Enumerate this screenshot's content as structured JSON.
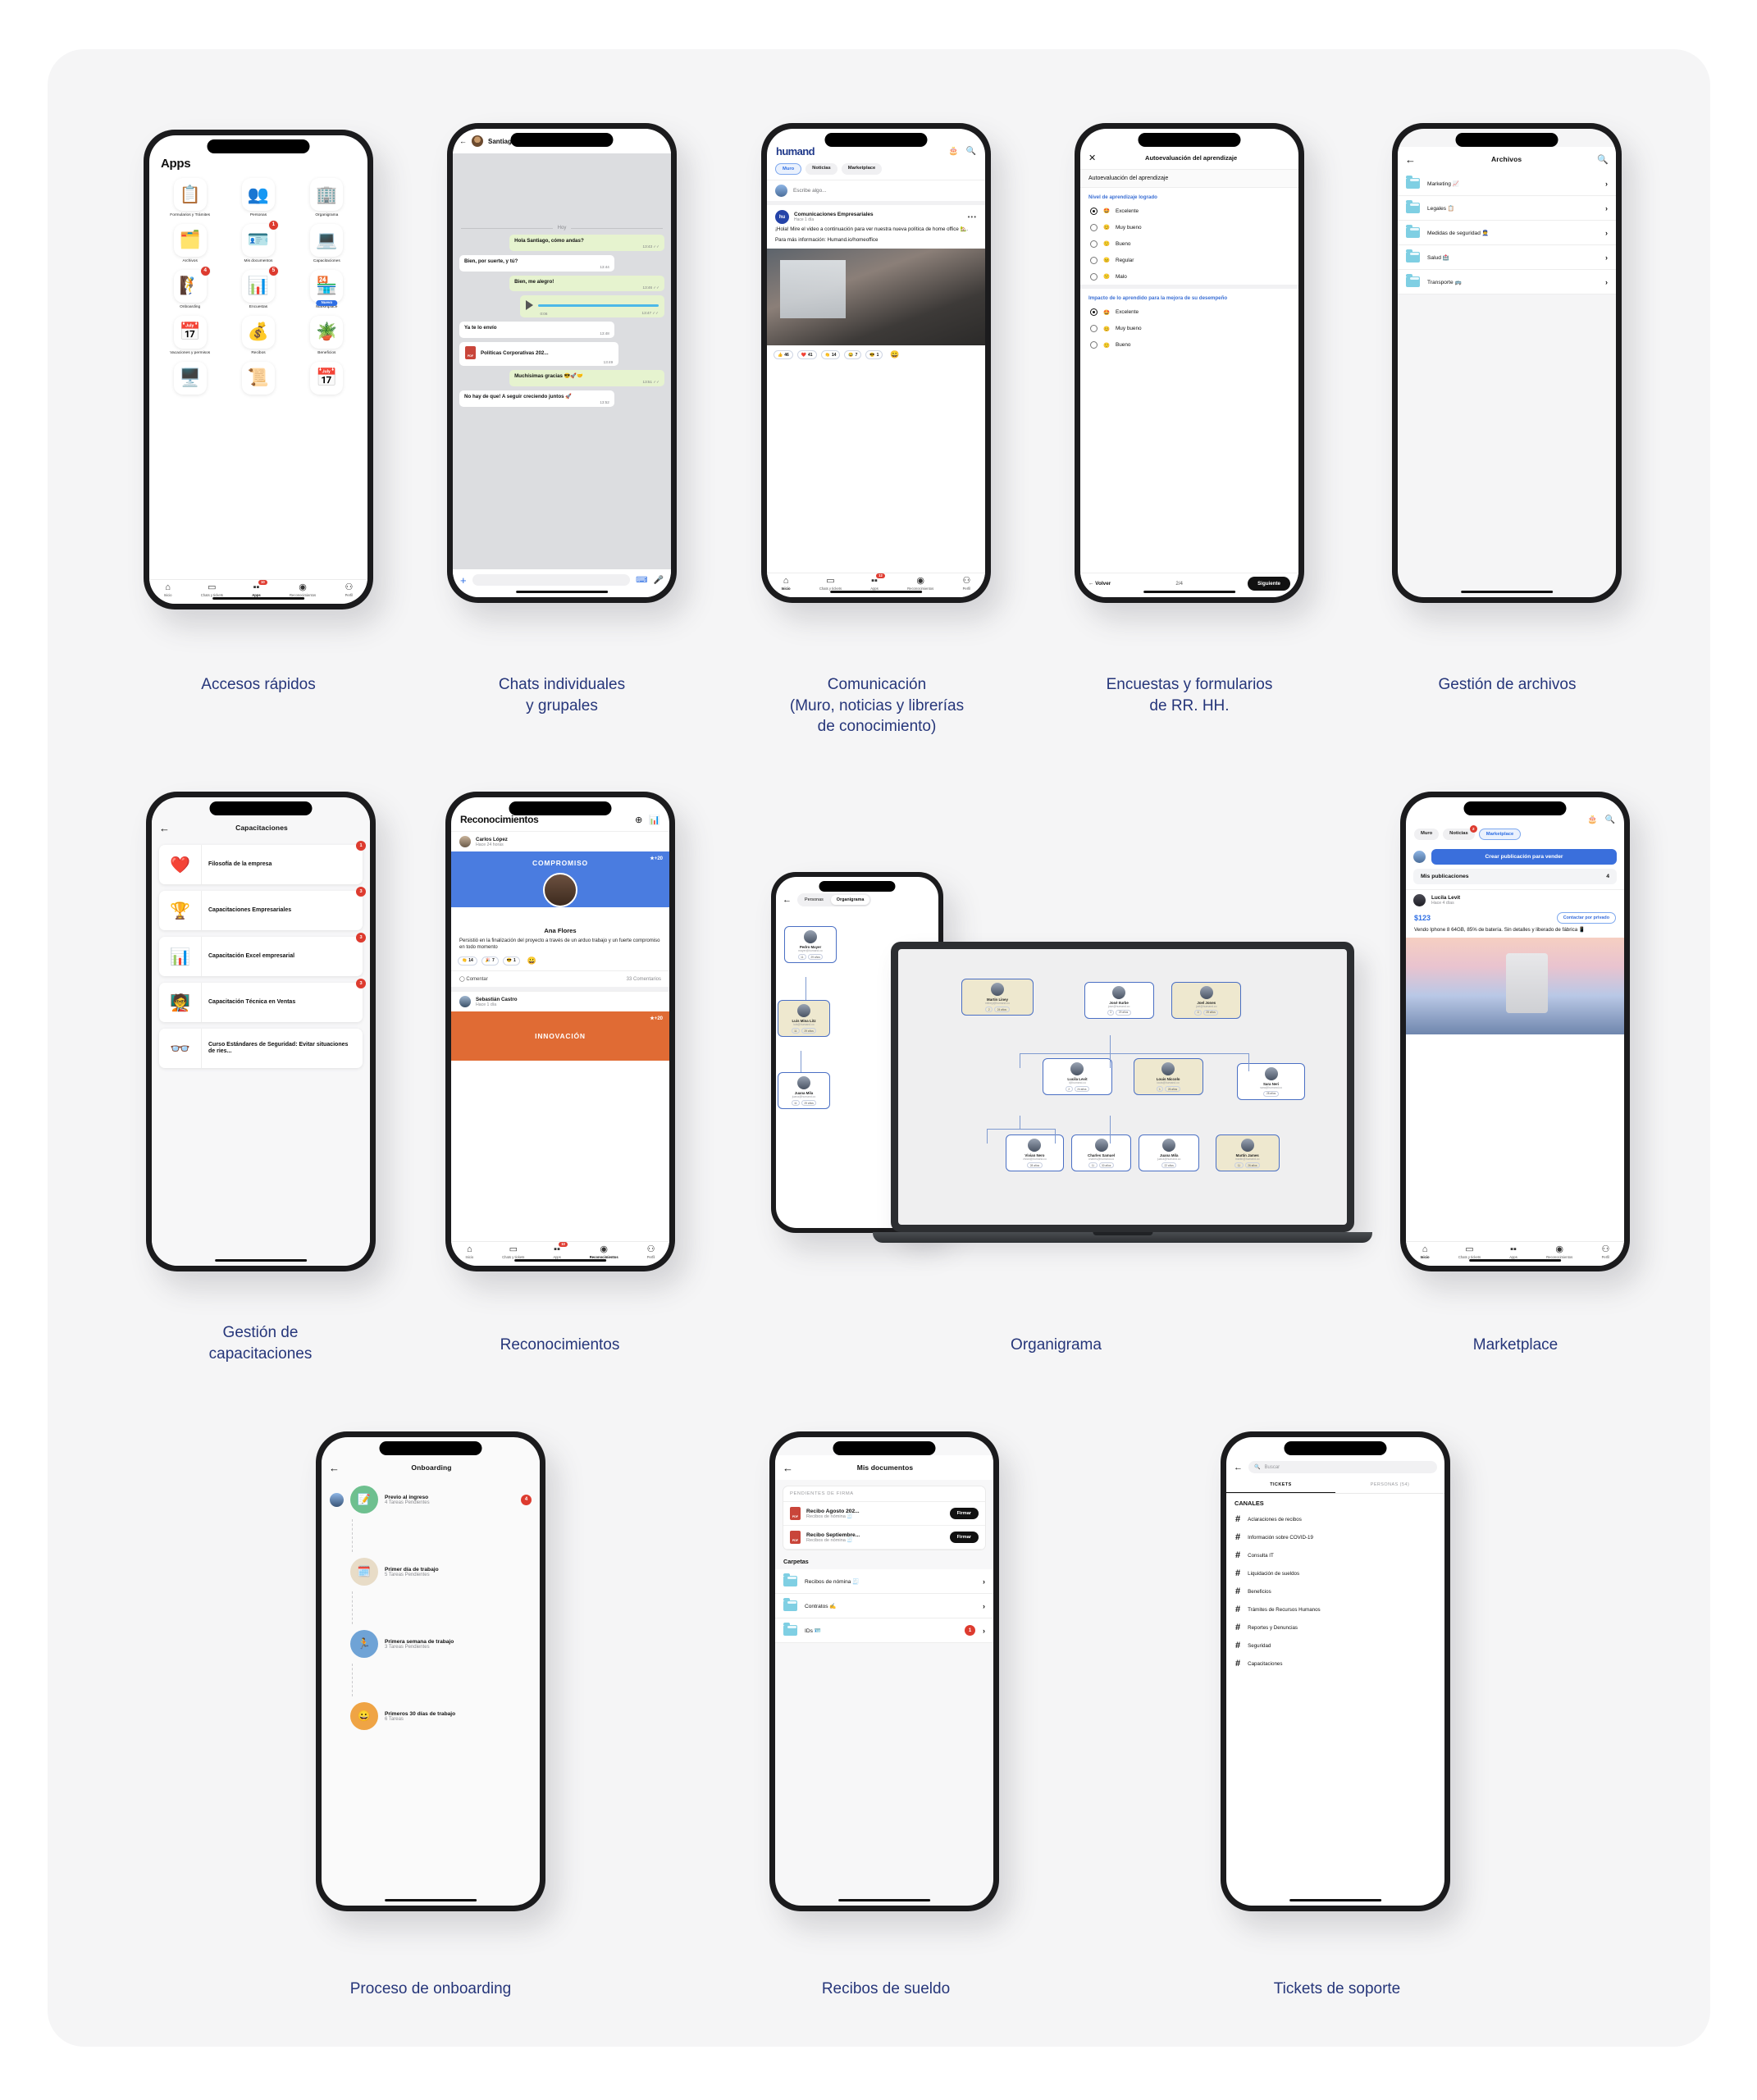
{
  "captions": {
    "c1": "Accesos rápidos",
    "c2": "Chats individuales\ny grupales",
    "c3": "Comunicación\n(Muro, noticias y librerías\nde conocimiento)",
    "c4": "Encuestas y formularios\nde RR. HH.",
    "c5": "Gestión de archivos",
    "c6": "Gestión de\ncapacitaciones",
    "c7": "Reconocimientos",
    "c8": "Organigrama",
    "c9": "Marketplace",
    "c10": "Proceso de onboarding",
    "c11": "Recibos de sueldo",
    "c12": "Tickets de soporte"
  },
  "colors": {
    "caption": "#26367a",
    "brand_blue": "#20398a",
    "accent_blue": "#2f6fe4",
    "badge_red": "#dd3b2f",
    "panel_bg": "#f5f5f6"
  },
  "apps_screen": {
    "title": "Apps",
    "tiles": [
      {
        "label": "Formularios y Trámites",
        "icon": "clipboard-pen-icon",
        "glyph": "📋",
        "badge": ""
      },
      {
        "label": "Personas",
        "icon": "people-icon",
        "glyph": "👥",
        "badge": ""
      },
      {
        "label": "Organigrama",
        "icon": "org-chart-icon",
        "glyph": "🏢",
        "badge": ""
      },
      {
        "label": "Archivos",
        "icon": "folders-icon",
        "glyph": "🗂️",
        "badge": ""
      },
      {
        "label": "Mis documentos",
        "icon": "id-card-check-icon",
        "glyph": "🪪",
        "badge": "1"
      },
      {
        "label": "Capacitaciones",
        "icon": "laptop-video-icon",
        "glyph": "💻",
        "badge": ""
      },
      {
        "label": "Onboarding",
        "icon": "climbing-icon",
        "glyph": "🧗",
        "badge": "4"
      },
      {
        "label": "Encuestas",
        "icon": "survey-icon",
        "glyph": "📊",
        "badge": "5"
      },
      {
        "label": "Marketplace",
        "icon": "storefront-icon",
        "glyph": "🏪",
        "badge": "",
        "pill": "Nuevo"
      },
      {
        "label": "Vacaciones y permisos",
        "icon": "calendar-icon",
        "glyph": "📅",
        "badge": ""
      },
      {
        "label": "Recibos",
        "icon": "money-icon",
        "glyph": "💰",
        "badge": ""
      },
      {
        "label": "Beneficios",
        "icon": "plant-coin-icon",
        "glyph": "🪴",
        "badge": ""
      },
      {
        "label": "",
        "icon": "monitor-icon",
        "glyph": "🖥️",
        "badge": ""
      },
      {
        "label": "",
        "icon": "scroll-icon",
        "glyph": "📜",
        "badge": ""
      },
      {
        "label": "",
        "icon": "calendar2-icon",
        "glyph": "📅",
        "badge": ""
      }
    ],
    "tabbar": [
      {
        "label": "Inicio",
        "icon": "home-icon",
        "glyph": "⌂",
        "active": false,
        "badge": ""
      },
      {
        "label": "Chats y tickets",
        "icon": "chat-icon",
        "glyph": "▭",
        "active": false,
        "badge": ""
      },
      {
        "label": "Apps",
        "icon": "grid-icon",
        "glyph": "▪▪",
        "active": true,
        "badge": "10"
      },
      {
        "label": "Reconocimientos",
        "icon": "award-icon",
        "glyph": "◉",
        "active": false,
        "badge": ""
      },
      {
        "label": "Perfil",
        "icon": "person-icon",
        "glyph": "⚇",
        "active": false,
        "badge": ""
      }
    ]
  },
  "chat_screen": {
    "contact": "Santiago Miranda",
    "day_divider": "Hoy",
    "messages": [
      {
        "side": "out",
        "text": "Hola Santiago, cómo andas?",
        "time": "13:43"
      },
      {
        "side": "in",
        "text": "Bien, por suerte, y tú?",
        "time": "13:44"
      },
      {
        "side": "out",
        "text": "Bien, me alegro!",
        "time": "13:46"
      },
      {
        "side": "audio",
        "duration": "0:06",
        "time": "13:47"
      },
      {
        "side": "in",
        "text": "Ya te lo envío",
        "time": "13:48"
      },
      {
        "side": "file",
        "text": "Políticas Corporativas 202...",
        "time": "13:49",
        "filetype": "PDF"
      },
      {
        "side": "out",
        "text": "Muchísimas gracias 😎🚀🤝",
        "time": "13:51"
      },
      {
        "side": "in",
        "text": "No hay de que! A seguir creciendo juntos 🚀",
        "time": "13:52"
      }
    ],
    "composer_placeholder": ""
  },
  "muro_screen": {
    "brand": "humand",
    "segments": [
      {
        "label": "Muro",
        "active": true,
        "badge": ""
      },
      {
        "label": "Noticias",
        "active": false,
        "badge": ""
      },
      {
        "label": "Marketplace",
        "active": false,
        "badge": ""
      }
    ],
    "composer_placeholder": "Escribe algo...",
    "post": {
      "author": "Comunicaciones Empresariales",
      "avatar_initials": "hu",
      "time": "Hace 1 día",
      "body_line1": "¡Hola! Mire el video a continuación para ver nuestra nueva política de home office 🏡.",
      "body_line2": "Para más información: Humand.io/homeoffice",
      "reactions": [
        {
          "glyph": "👍",
          "count": "46"
        },
        {
          "glyph": "❤️",
          "count": "41"
        },
        {
          "glyph": "👏",
          "count": "14"
        },
        {
          "glyph": "😂",
          "count": "7"
        },
        {
          "glyph": "😎",
          "count": "1"
        }
      ],
      "add_reaction": "😀"
    },
    "tabbar": [
      {
        "label": "Inicio",
        "glyph": "⌂",
        "active": true,
        "badge": ""
      },
      {
        "label": "Chats y tickets",
        "glyph": "▭",
        "active": false,
        "badge": ""
      },
      {
        "label": "Apps",
        "glyph": "▪▪",
        "active": false,
        "badge": "12"
      },
      {
        "label": "Reconocimientos",
        "glyph": "◉",
        "active": false,
        "badge": ""
      },
      {
        "label": "Perfil",
        "glyph": "⚇",
        "active": false,
        "badge": ""
      }
    ]
  },
  "survey_screen": {
    "header_title": "Autoevaluación del aprendizaje",
    "subtitle": "Autoevaluación del aprendizaje",
    "q1": {
      "label": "Nivel de aprendizaje logrado",
      "options": [
        {
          "glyph": "🤩",
          "label": "Excelente",
          "selected": true
        },
        {
          "glyph": "😊",
          "label": "Muy bueno",
          "selected": false
        },
        {
          "glyph": "🙂",
          "label": "Bueno",
          "selected": false
        },
        {
          "glyph": "😐",
          "label": "Regular",
          "selected": false
        },
        {
          "glyph": "🙁",
          "label": "Malo",
          "selected": false
        }
      ]
    },
    "q2": {
      "label": "Impacto de lo aprendido para la mejora de su desempeño",
      "options": [
        {
          "glyph": "🤩",
          "label": "Excelente",
          "selected": true
        },
        {
          "glyph": "😊",
          "label": "Muy bueno",
          "selected": false
        },
        {
          "glyph": "🙂",
          "label": "Bueno",
          "selected": false
        }
      ]
    },
    "back_label": "Volver",
    "page_indicator": "2/4",
    "next_label": "Siguiente"
  },
  "archivos_screen": {
    "title": "Archivos",
    "folders": [
      {
        "label": "Marketing 📈"
      },
      {
        "label": "Legales 📋"
      },
      {
        "label": "Medidas de seguridad 👮"
      },
      {
        "label": "Salud 🏥"
      },
      {
        "label": "Transporte 🚌"
      }
    ]
  },
  "capacitaciones_screen": {
    "title": "Capacitaciones",
    "items": [
      {
        "title": "Filosofía de la empresa",
        "glyph": "❤️",
        "badge": "1"
      },
      {
        "title": "Capacitaciones Empresariales",
        "glyph": "🏆",
        "badge": "3"
      },
      {
        "title": "Capacitación Excel empresarial",
        "glyph": "📊",
        "badge": "3"
      },
      {
        "title": "Capacitación Técnica en Ventas",
        "glyph": "🧑‍🏫",
        "badge": "3"
      },
      {
        "title": "Curso Estándares de Seguridad: Evitar situaciones de ries...",
        "glyph": "👓",
        "badge": ""
      }
    ]
  },
  "reconocimientos_screen": {
    "title": "Reconocimientos",
    "add_icon": "plus-circle-icon",
    "ranking_icon": "ranking-icon",
    "posts": [
      {
        "author": "Carlos López",
        "time": "Hace 24 horas",
        "banner_label": "COMPROMISO",
        "banner_color": "#4a7ce0",
        "points": "+20",
        "recipient": "Ana Flores",
        "description": "Persistió en la finalización del proyecto a través de un arduo trabajo y un fuerte compromiso en todo momento",
        "reactions": [
          {
            "glyph": "👏",
            "count": "14"
          },
          {
            "glyph": "🎉",
            "count": "7"
          },
          {
            "glyph": "😎",
            "count": "1"
          }
        ],
        "comment_label": "Comentar",
        "comments_count": "33 Comentarios"
      },
      {
        "author": "Sebastián Castro",
        "time": "Hace 1 día",
        "banner_label": "INNOVACIÓN",
        "banner_color": "#e06b34",
        "points": "+20"
      }
    ],
    "tabbar": [
      {
        "label": "Inicio",
        "glyph": "⌂",
        "active": false,
        "badge": ""
      },
      {
        "label": "Chats y tickets",
        "glyph": "▭",
        "active": false,
        "badge": ""
      },
      {
        "label": "Apps",
        "glyph": "▪▪",
        "active": false,
        "badge": "10"
      },
      {
        "label": "Reconocimientos",
        "glyph": "◉",
        "active": true,
        "badge": ""
      },
      {
        "label": "Perfil",
        "glyph": "⚇",
        "active": false,
        "badge": ""
      }
    ]
  },
  "marketplace_screen": {
    "segments": [
      {
        "label": "Muro",
        "active": false,
        "badge": ""
      },
      {
        "label": "Noticias",
        "active": false,
        "badge": "2"
      },
      {
        "label": "Marketplace",
        "active": true,
        "badge": ""
      }
    ],
    "create_button": "Crear publicación para vender",
    "my_posts_label": "Mis publicaciones",
    "my_posts_count": "4",
    "listing": {
      "seller": "Lucila Levit",
      "time": "Hace 4 días",
      "price": "$123",
      "contact_button": "Contactar por privado",
      "description": "Vendo Iphone 8 64GB, 85% de batería. Sin detalles y liberado de fábrica 📱"
    },
    "tabbar": [
      {
        "label": "Inicio",
        "glyph": "⌂",
        "active": true,
        "badge": ""
      },
      {
        "label": "Chats y tickets",
        "glyph": "▭",
        "active": false,
        "badge": ""
      },
      {
        "label": "Apps",
        "glyph": "▪▪",
        "active": false,
        "badge": ""
      },
      {
        "label": "Reconocimientos",
        "glyph": "◉",
        "active": false,
        "badge": ""
      },
      {
        "label": "Perfil",
        "glyph": "⚇",
        "active": false,
        "badge": ""
      }
    ]
  },
  "onboarding_screen": {
    "title": "Onboarding",
    "steps": [
      {
        "title": "Previo al ingreso",
        "subtitle": "4 Tareas Pendientes",
        "glyph": "📝",
        "bg": "#6ec08f",
        "badge": "4"
      },
      {
        "title": "Primer día de trabajo",
        "subtitle": "5 Tareas Pendientes",
        "glyph": "🗓️",
        "bg": "#e8dcc7",
        "badge": ""
      },
      {
        "title": "Primera semana de trabajo",
        "subtitle": "3 Tareas Pendientes",
        "glyph": "🏃",
        "bg": "#6fa3d6",
        "badge": ""
      },
      {
        "title": "Primeros 30 días de trabajo",
        "subtitle": "6 Tareas",
        "glyph": "😀",
        "bg": "#efa445",
        "badge": ""
      }
    ]
  },
  "documentos_screen": {
    "title": "Mis documentos",
    "pending_header": "PENDIENTES DE FIRMA",
    "pending": [
      {
        "name": "Recibo Agosto 202...",
        "folder": "Recibos de nómina 🧾",
        "button": "Firmar",
        "type": "PDF"
      },
      {
        "name": "Recibo Septiembre...",
        "folder": "Recibos de nómina 🧾",
        "button": "Firmar",
        "type": "PDF"
      }
    ],
    "folders_header": "Carpetas",
    "folders": [
      {
        "label": "Recibos de nómina 🧾",
        "badge": ""
      },
      {
        "label": "Contratos ✍️",
        "badge": ""
      },
      {
        "label": "IDs 🪪",
        "badge": "1"
      }
    ]
  },
  "tickets_screen": {
    "search_placeholder": "Buscar",
    "tabs": [
      {
        "label": "TICKETS",
        "active": true
      },
      {
        "label": "PERSONAS (54)",
        "active": false
      }
    ],
    "section_header": "CANALES",
    "channels": [
      "Aclaraciones de recibos",
      "Información sobre COVID-19",
      "Consulta IT",
      "Liquidación de sueldos",
      "Beneficios",
      "Trámites de Recursos Humanos",
      "Reportes y Denuncias",
      "Seguridad",
      "Capacitaciones"
    ]
  },
  "organigrama_screen": {
    "segments": [
      {
        "label": "Personas",
        "active": false
      },
      {
        "label": "Organigrama",
        "active": true
      }
    ],
    "phone_nodes": [
      {
        "name": "Pedro Mayer",
        "email": "mayer@humand.co",
        "tan": false
      },
      {
        "name": "Luis Mina Litz",
        "email": "luis@humand.co",
        "tan": true
      },
      {
        "name": "Juana Mila",
        "email": "juana@humand.co",
        "tan": false
      }
    ],
    "desktop_nodes": [
      {
        "name": "Martin Liney",
        "email": "mliney@humand.co",
        "age": "24 años",
        "reports": "2",
        "tan": true,
        "row": 1
      },
      {
        "name": "José Iturbe",
        "email": "jose@humand.co",
        "age": "29 años",
        "reports": "3",
        "tan": false,
        "row": 1
      },
      {
        "name": "Joel Jones",
        "email": "joel@humand.co",
        "age": "29 años",
        "reports": "4",
        "tan": true,
        "row": 1
      },
      {
        "name": "Lucila Levit",
        "email": "l@humand.co",
        "age": "24 años",
        "reports": "2",
        "tan": false,
        "row": 2
      },
      {
        "name": "Louis Niccolo",
        "email": "louis@humand.co",
        "age": "26 años",
        "reports": "1",
        "tan": true,
        "row": 2
      },
      {
        "name": "Sara Neri",
        "email": "sara@humand.co",
        "age": "28 años",
        "reports": "",
        "tan": false,
        "row": 2
      },
      {
        "name": "Vivian Nero",
        "email": "vivian@humand.co",
        "age": "28 años",
        "reports": "",
        "tan": false,
        "row": 3
      },
      {
        "name": "Charles Samuel",
        "email": "charles@humand.co",
        "age": "30 años",
        "reports": "11",
        "tan": false,
        "row": 3
      },
      {
        "name": "Juana Mila",
        "email": "juana@humand.co",
        "age": "22 años",
        "reports": "",
        "tan": false,
        "row": 3
      },
      {
        "name": "Martin James",
        "email": "martin@humand.co",
        "age": "26 años",
        "reports": "11",
        "tan": true,
        "row": 3
      }
    ]
  }
}
